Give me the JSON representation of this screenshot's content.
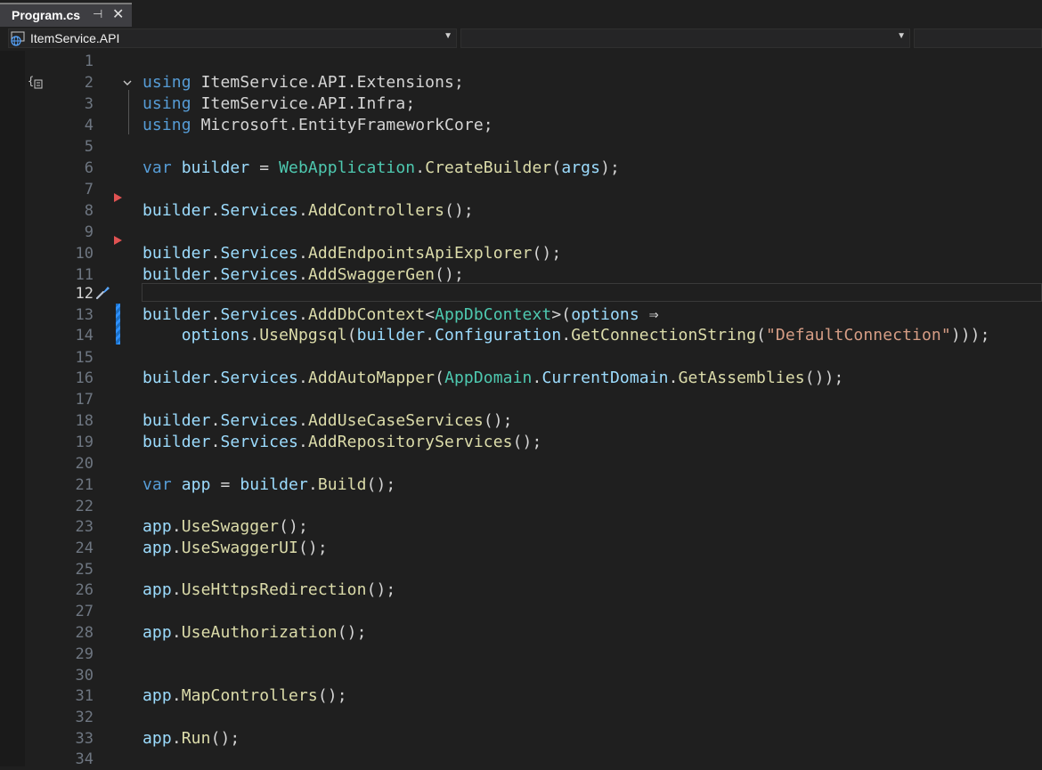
{
  "tab": {
    "title": "Program.cs",
    "pin_icon": "pin-icon",
    "close_icon": "close-icon"
  },
  "nav": {
    "project": "ItemService.API",
    "project_icon": "globe-project-icon",
    "member": ""
  },
  "editor": {
    "current_line": 12,
    "lines": [
      {
        "n": "1",
        "tokens": []
      },
      {
        "n": "2",
        "tokens": [
          [
            "kw",
            "using"
          ],
          [
            "pl",
            " "
          ],
          [
            "ns",
            "ItemService.API.Extensions"
          ],
          [
            "pl",
            ";"
          ]
        ]
      },
      {
        "n": "3",
        "tokens": [
          [
            "kw",
            "using"
          ],
          [
            "pl",
            " "
          ],
          [
            "ns",
            "ItemService.API.Infra"
          ],
          [
            "pl",
            ";"
          ]
        ]
      },
      {
        "n": "4",
        "tokens": [
          [
            "kw",
            "using"
          ],
          [
            "pl",
            " "
          ],
          [
            "ns",
            "Microsoft.EntityFrameworkCore"
          ],
          [
            "pl",
            ";"
          ]
        ]
      },
      {
        "n": "5",
        "tokens": []
      },
      {
        "n": "6",
        "tokens": [
          [
            "kw",
            "var"
          ],
          [
            "pl",
            " "
          ],
          [
            "id",
            "builder"
          ],
          [
            "pl",
            " = "
          ],
          [
            "tp",
            "WebApplication"
          ],
          [
            "pl",
            "."
          ],
          [
            "mt",
            "CreateBuilder"
          ],
          [
            "pl",
            "("
          ],
          [
            "id",
            "args"
          ],
          [
            "pl",
            ");"
          ]
        ]
      },
      {
        "n": "7",
        "tokens": []
      },
      {
        "n": "8",
        "tokens": [
          [
            "id",
            "builder"
          ],
          [
            "pl",
            "."
          ],
          [
            "id",
            "Services"
          ],
          [
            "pl",
            "."
          ],
          [
            "mt",
            "AddControllers"
          ],
          [
            "pl",
            "();"
          ]
        ]
      },
      {
        "n": "9",
        "tokens": []
      },
      {
        "n": "10",
        "tokens": [
          [
            "id",
            "builder"
          ],
          [
            "pl",
            "."
          ],
          [
            "id",
            "Services"
          ],
          [
            "pl",
            "."
          ],
          [
            "mt",
            "AddEndpointsApiExplorer"
          ],
          [
            "pl",
            "();"
          ]
        ]
      },
      {
        "n": "11",
        "tokens": [
          [
            "id",
            "builder"
          ],
          [
            "pl",
            "."
          ],
          [
            "id",
            "Services"
          ],
          [
            "pl",
            "."
          ],
          [
            "mt",
            "AddSwaggerGen"
          ],
          [
            "pl",
            "();"
          ]
        ]
      },
      {
        "n": "12",
        "tokens": []
      },
      {
        "n": "13",
        "tokens": [
          [
            "id",
            "builder"
          ],
          [
            "pl",
            "."
          ],
          [
            "id",
            "Services"
          ],
          [
            "pl",
            "."
          ],
          [
            "mt",
            "AddDbContext"
          ],
          [
            "pl",
            "<"
          ],
          [
            "tp",
            "AppDbContext"
          ],
          [
            "pl",
            ">("
          ],
          [
            "id",
            "options"
          ],
          [
            "pl",
            " ⇒"
          ]
        ]
      },
      {
        "n": "14",
        "tokens": [
          [
            "pl",
            "    "
          ],
          [
            "id",
            "options"
          ],
          [
            "pl",
            "."
          ],
          [
            "mt",
            "UseNpgsql"
          ],
          [
            "pl",
            "("
          ],
          [
            "id",
            "builder"
          ],
          [
            "pl",
            "."
          ],
          [
            "id",
            "Configuration"
          ],
          [
            "pl",
            "."
          ],
          [
            "mt",
            "GetConnectionString"
          ],
          [
            "pl",
            "("
          ],
          [
            "st",
            "\"DefaultConnection\""
          ],
          [
            "pl",
            ")));"
          ]
        ]
      },
      {
        "n": "15",
        "tokens": []
      },
      {
        "n": "16",
        "tokens": [
          [
            "id",
            "builder"
          ],
          [
            "pl",
            "."
          ],
          [
            "id",
            "Services"
          ],
          [
            "pl",
            "."
          ],
          [
            "mt",
            "AddAutoMapper"
          ],
          [
            "pl",
            "("
          ],
          [
            "tp",
            "AppDomain"
          ],
          [
            "pl",
            "."
          ],
          [
            "id",
            "CurrentDomain"
          ],
          [
            "pl",
            "."
          ],
          [
            "mt",
            "GetAssemblies"
          ],
          [
            "pl",
            "());"
          ]
        ]
      },
      {
        "n": "17",
        "tokens": []
      },
      {
        "n": "18",
        "tokens": [
          [
            "id",
            "builder"
          ],
          [
            "pl",
            "."
          ],
          [
            "id",
            "Services"
          ],
          [
            "pl",
            "."
          ],
          [
            "mt",
            "AddUseCaseServices"
          ],
          [
            "pl",
            "();"
          ]
        ]
      },
      {
        "n": "19",
        "tokens": [
          [
            "id",
            "builder"
          ],
          [
            "pl",
            "."
          ],
          [
            "id",
            "Services"
          ],
          [
            "pl",
            "."
          ],
          [
            "mt",
            "AddRepositoryServices"
          ],
          [
            "pl",
            "();"
          ]
        ]
      },
      {
        "n": "20",
        "tokens": []
      },
      {
        "n": "21",
        "tokens": [
          [
            "kw",
            "var"
          ],
          [
            "pl",
            " "
          ],
          [
            "id",
            "app"
          ],
          [
            "pl",
            " = "
          ],
          [
            "id",
            "builder"
          ],
          [
            "pl",
            "."
          ],
          [
            "mt",
            "Build"
          ],
          [
            "pl",
            "();"
          ]
        ]
      },
      {
        "n": "22",
        "tokens": []
      },
      {
        "n": "23",
        "tokens": [
          [
            "id",
            "app"
          ],
          [
            "pl",
            "."
          ],
          [
            "mt",
            "UseSwagger"
          ],
          [
            "pl",
            "();"
          ]
        ]
      },
      {
        "n": "24",
        "tokens": [
          [
            "id",
            "app"
          ],
          [
            "pl",
            "."
          ],
          [
            "mt",
            "UseSwaggerUI"
          ],
          [
            "pl",
            "();"
          ]
        ]
      },
      {
        "n": "25",
        "tokens": []
      },
      {
        "n": "26",
        "tokens": [
          [
            "id",
            "app"
          ],
          [
            "pl",
            "."
          ],
          [
            "mt",
            "UseHttpsRedirection"
          ],
          [
            "pl",
            "();"
          ]
        ]
      },
      {
        "n": "27",
        "tokens": []
      },
      {
        "n": "28",
        "tokens": [
          [
            "id",
            "app"
          ],
          [
            "pl",
            "."
          ],
          [
            "mt",
            "UseAuthorization"
          ],
          [
            "pl",
            "();"
          ]
        ]
      },
      {
        "n": "29",
        "tokens": []
      },
      {
        "n": "30",
        "tokens": []
      },
      {
        "n": "31",
        "tokens": [
          [
            "id",
            "app"
          ],
          [
            "pl",
            "."
          ],
          [
            "mt",
            "MapControllers"
          ],
          [
            "pl",
            "();"
          ]
        ]
      },
      {
        "n": "32",
        "tokens": []
      },
      {
        "n": "33",
        "tokens": [
          [
            "id",
            "app"
          ],
          [
            "pl",
            "."
          ],
          [
            "mt",
            "Run"
          ],
          [
            "pl",
            "();"
          ]
        ]
      },
      {
        "n": "34",
        "tokens": []
      }
    ]
  },
  "colors": {
    "keyword": "#569cd6",
    "identifier": "#9cdcfe",
    "type": "#4ec9b0",
    "method": "#dcdcaa",
    "string": "#d69d85",
    "plain": "#d4d4d4",
    "breakpoint_marker": "#e05252",
    "change_bar": "#2e90ff"
  },
  "gutter_icons": {
    "line_2": "snippet-icon",
    "line_8": "breakpoint-arrow-icon",
    "line_10": "breakpoint-arrow-icon",
    "line_12": "paintbrush-quick-action-icon"
  }
}
